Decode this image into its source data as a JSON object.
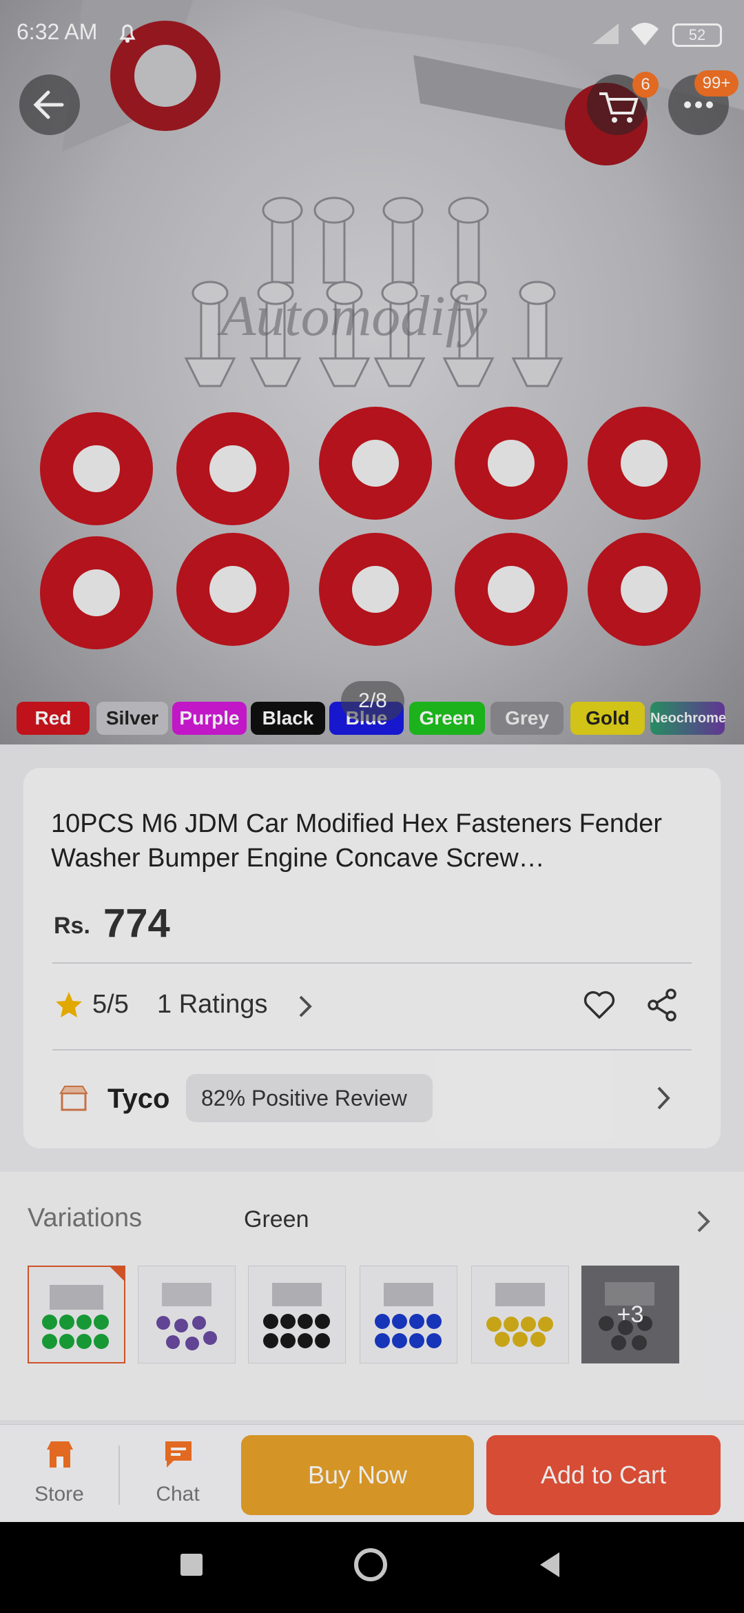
{
  "status": {
    "time": "6:32 AM",
    "battery": "52"
  },
  "header": {
    "cart_badge": "6",
    "more_badge": "99+"
  },
  "gallery": {
    "watermark": "Automodify",
    "pager": "2/8",
    "chips": [
      "Red",
      "Silver",
      "Purple",
      "Black",
      "Blue",
      "Green",
      "Grey",
      "Gold",
      "Neochrome"
    ]
  },
  "product": {
    "title": "10PCS M6 JDM Car Modified Hex Fasteners Fender Washer Bumper Engine Concave Screw…",
    "currency": "Rs.",
    "price": "774",
    "rating": "5/5",
    "ratings_count": "1 Ratings",
    "store_name": "Tyco",
    "positive_review": "82% Positive Review"
  },
  "variations": {
    "label": "Variations",
    "selected": "Green",
    "more_count": "+3"
  },
  "bottom": {
    "store_label": "Store",
    "chat_label": "Chat",
    "buy_now": "Buy Now",
    "add_to_cart": "Add to Cart"
  },
  "colors": {
    "accent": "#f57224",
    "buy_now": "#e6a12a",
    "add_to_cart": "#e9533a"
  }
}
